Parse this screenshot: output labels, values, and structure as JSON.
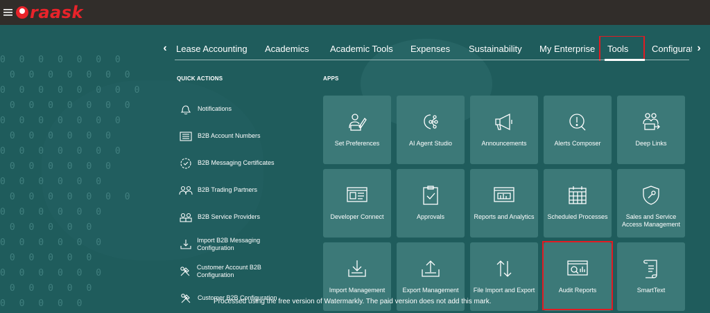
{
  "app": {
    "logo_text": "raask"
  },
  "nav": {
    "prev_arrow": "‹",
    "next_arrow": "›",
    "tabs": [
      {
        "label": "Lease Accounting"
      },
      {
        "label": "Academics"
      },
      {
        "label": "Academic Tools"
      },
      {
        "label": "Expenses"
      },
      {
        "label": "Sustainability"
      },
      {
        "label": "My Enterprise"
      },
      {
        "label": "Tools",
        "selected": true
      },
      {
        "label": "Configurat"
      }
    ]
  },
  "quick_actions": {
    "heading": "QUICK ACTIONS",
    "items": [
      {
        "label": "Notifications",
        "icon": "bell-icon"
      },
      {
        "label": "B2B Account Numbers",
        "icon": "list-icon"
      },
      {
        "label": "B2B Messaging Certificates",
        "icon": "certificate-icon"
      },
      {
        "label": "B2B Trading Partners",
        "icon": "partners-icon"
      },
      {
        "label": "B2B Service Providers",
        "icon": "providers-icon"
      },
      {
        "label": "Import B2B Messaging Configuration",
        "icon": "import-icon"
      },
      {
        "label": "Customer Account B2B Configuration",
        "icon": "tools-icon"
      },
      {
        "label": "Customer B2B Configuration",
        "icon": "tools-icon"
      }
    ]
  },
  "apps": {
    "heading": "APPS",
    "tiles": [
      {
        "label": "Set Preferences",
        "icon": "preferences-icon"
      },
      {
        "label": "AI Agent Studio",
        "icon": "ai-agent-icon"
      },
      {
        "label": "Announcements",
        "icon": "megaphone-icon"
      },
      {
        "label": "Alerts Composer",
        "icon": "alert-icon"
      },
      {
        "label": "Deep Links",
        "icon": "deep-links-icon"
      },
      {
        "label": "Developer Connect",
        "icon": "developer-icon"
      },
      {
        "label": "Approvals",
        "icon": "approvals-icon"
      },
      {
        "label": "Reports and Analytics",
        "icon": "reports-icon"
      },
      {
        "label": "Scheduled Processes",
        "icon": "calendar-icon"
      },
      {
        "label": "Sales and Service Access Management",
        "icon": "security-icon"
      },
      {
        "label": "Import Management",
        "icon": "import-tray-icon"
      },
      {
        "label": "Export Management",
        "icon": "export-tray-icon"
      },
      {
        "label": "File Import and Export",
        "icon": "file-transfer-icon"
      },
      {
        "label": "Audit Reports",
        "icon": "audit-icon",
        "highlighted": true
      },
      {
        "label": "SmartText",
        "icon": "scroll-icon"
      }
    ]
  },
  "footer": {
    "watermark": "Processed using the free version of Watermarkly. The paid version does not add this mark."
  },
  "colors": {
    "topbar": "#312d2a",
    "background": "#1f5c5c",
    "tile": "#3c7978",
    "highlight": "#e11b22",
    "logo": "#e8232a"
  }
}
